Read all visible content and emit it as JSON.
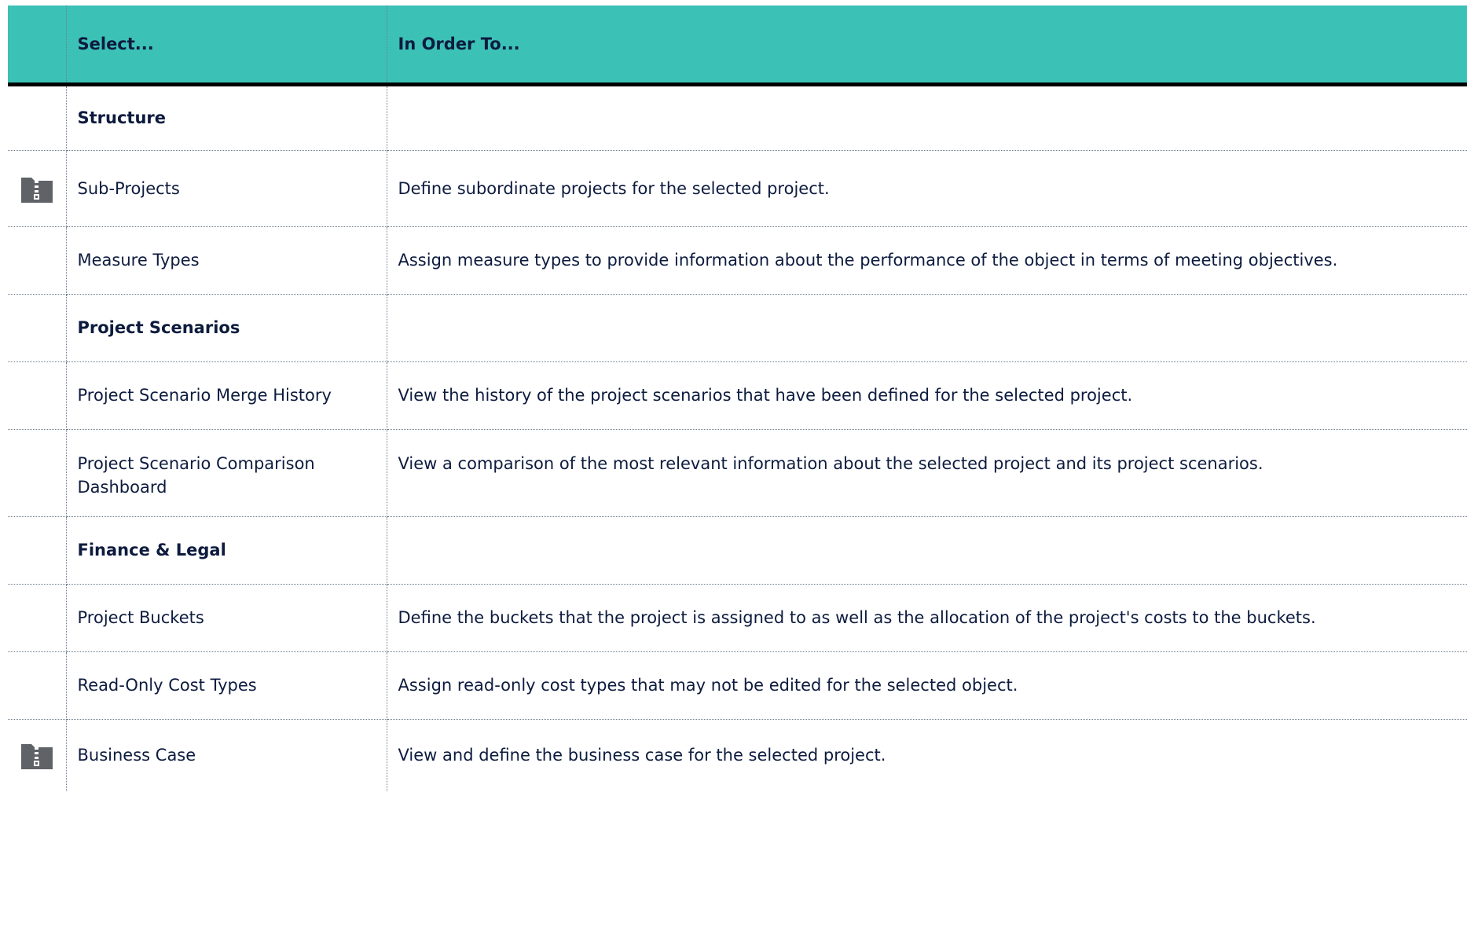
{
  "table": {
    "headers": {
      "icon": "",
      "select": "Select...",
      "order": "In Order To..."
    },
    "rows": [
      {
        "type": "section",
        "select": "Structure",
        "order": "",
        "icon": ""
      },
      {
        "type": "item",
        "select": "Sub-Projects",
        "order": "Define subordinate projects for the selected project.",
        "icon": "zip-folder-icon"
      },
      {
        "type": "item",
        "select": "Measure Types",
        "order": "Assign measure types to provide information about the performance of the object in terms of meeting objectives.",
        "icon": ""
      },
      {
        "type": "section",
        "select": "Project Scenarios",
        "order": "",
        "icon": ""
      },
      {
        "type": "item",
        "select": "Project Scenario Merge History",
        "order": "View the history of the project scenarios that have been defined for the selected project.",
        "icon": ""
      },
      {
        "type": "item",
        "select": "Project Scenario Comparison Dashboard",
        "order": "View a comparison of the most relevant information about the selected project and its project scenarios.",
        "icon": ""
      },
      {
        "type": "section",
        "select": "Finance & Legal",
        "order": "",
        "icon": ""
      },
      {
        "type": "item",
        "select": "Project Buckets",
        "order": "Define the buckets that the project is assigned to as well as the allocation of the project's costs to the buckets.",
        "icon": ""
      },
      {
        "type": "item",
        "select": "Read-Only Cost Types",
        "order": "Assign read-only cost types that may not be edited for the selected object.",
        "icon": ""
      },
      {
        "type": "item",
        "select": "Business Case",
        "order": "View and define the business case for the selected project.",
        "icon": "zip-folder-icon"
      }
    ]
  },
  "colors": {
    "header_bg": "#3cc1b7",
    "text": "#0d1b3e",
    "icon": "#5f6368"
  }
}
